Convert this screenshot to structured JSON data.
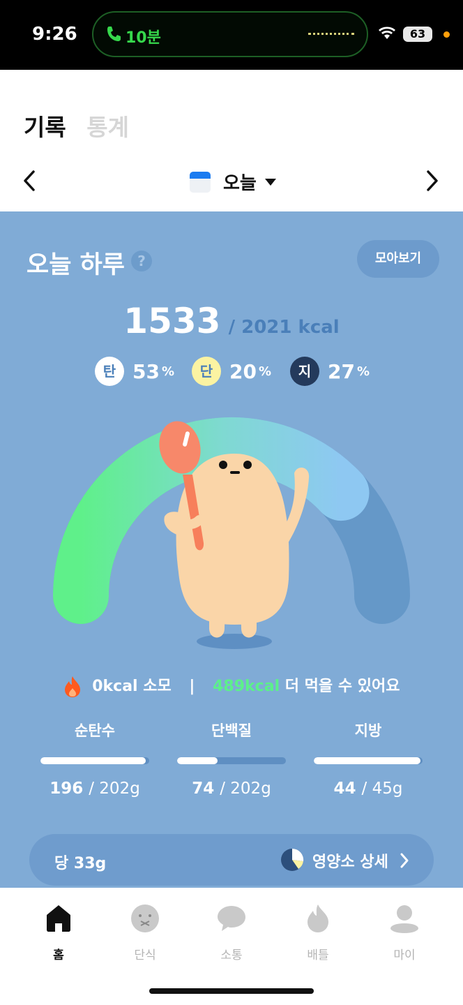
{
  "status_bar": {
    "time": "9:26",
    "call_duration": "10분",
    "battery": "63"
  },
  "header": {
    "tabs": [
      {
        "label": "기록"
      },
      {
        "label": "통계"
      }
    ],
    "date_label": "오늘"
  },
  "summary": {
    "title": "오늘 하루",
    "help": "?",
    "collect_button": "모아보기",
    "kcal_consumed": "1533",
    "kcal_goal": "/ 2021 kcal",
    "macros": [
      {
        "badge": "탄",
        "percent": "53",
        "unit": "%",
        "color": "#ffffff"
      },
      {
        "badge": "단",
        "percent": "20",
        "unit": "%",
        "color": "#fbf3a2"
      },
      {
        "badge": "지",
        "percent": "27",
        "unit": "%",
        "color": "#243a5c"
      }
    ],
    "gauge_progress": 0.76,
    "burn_text": "0kcal 소모",
    "separator": "|",
    "remaining_kcal": "489kcal",
    "remaining_text": "더 먹을 수 있어요"
  },
  "nutrients": [
    {
      "label": "순탄수",
      "consumed": "196",
      "goal": "/ 202g",
      "fraction": 0.97
    },
    {
      "label": "단백질",
      "consumed": "74",
      "goal": "/ 202g",
      "fraction": 0.37
    },
    {
      "label": "지방",
      "consumed": "44",
      "goal": "/ 45g",
      "fraction": 0.98
    }
  ],
  "detail": {
    "sugar": "당 33g",
    "link": "영양소 상세"
  },
  "nav": [
    {
      "label": "홈",
      "icon": "home-icon",
      "active": true
    },
    {
      "label": "단식",
      "icon": "fasting-icon",
      "active": false
    },
    {
      "label": "소통",
      "icon": "chat-bubble-icon",
      "active": false
    },
    {
      "label": "배틀",
      "icon": "flame-icon",
      "active": false
    },
    {
      "label": "마이",
      "icon": "person-icon",
      "active": false
    }
  ],
  "colors": {
    "panel": "#80abd6",
    "accent_green": "#5cf08a",
    "flame": "#ff5a1f"
  }
}
